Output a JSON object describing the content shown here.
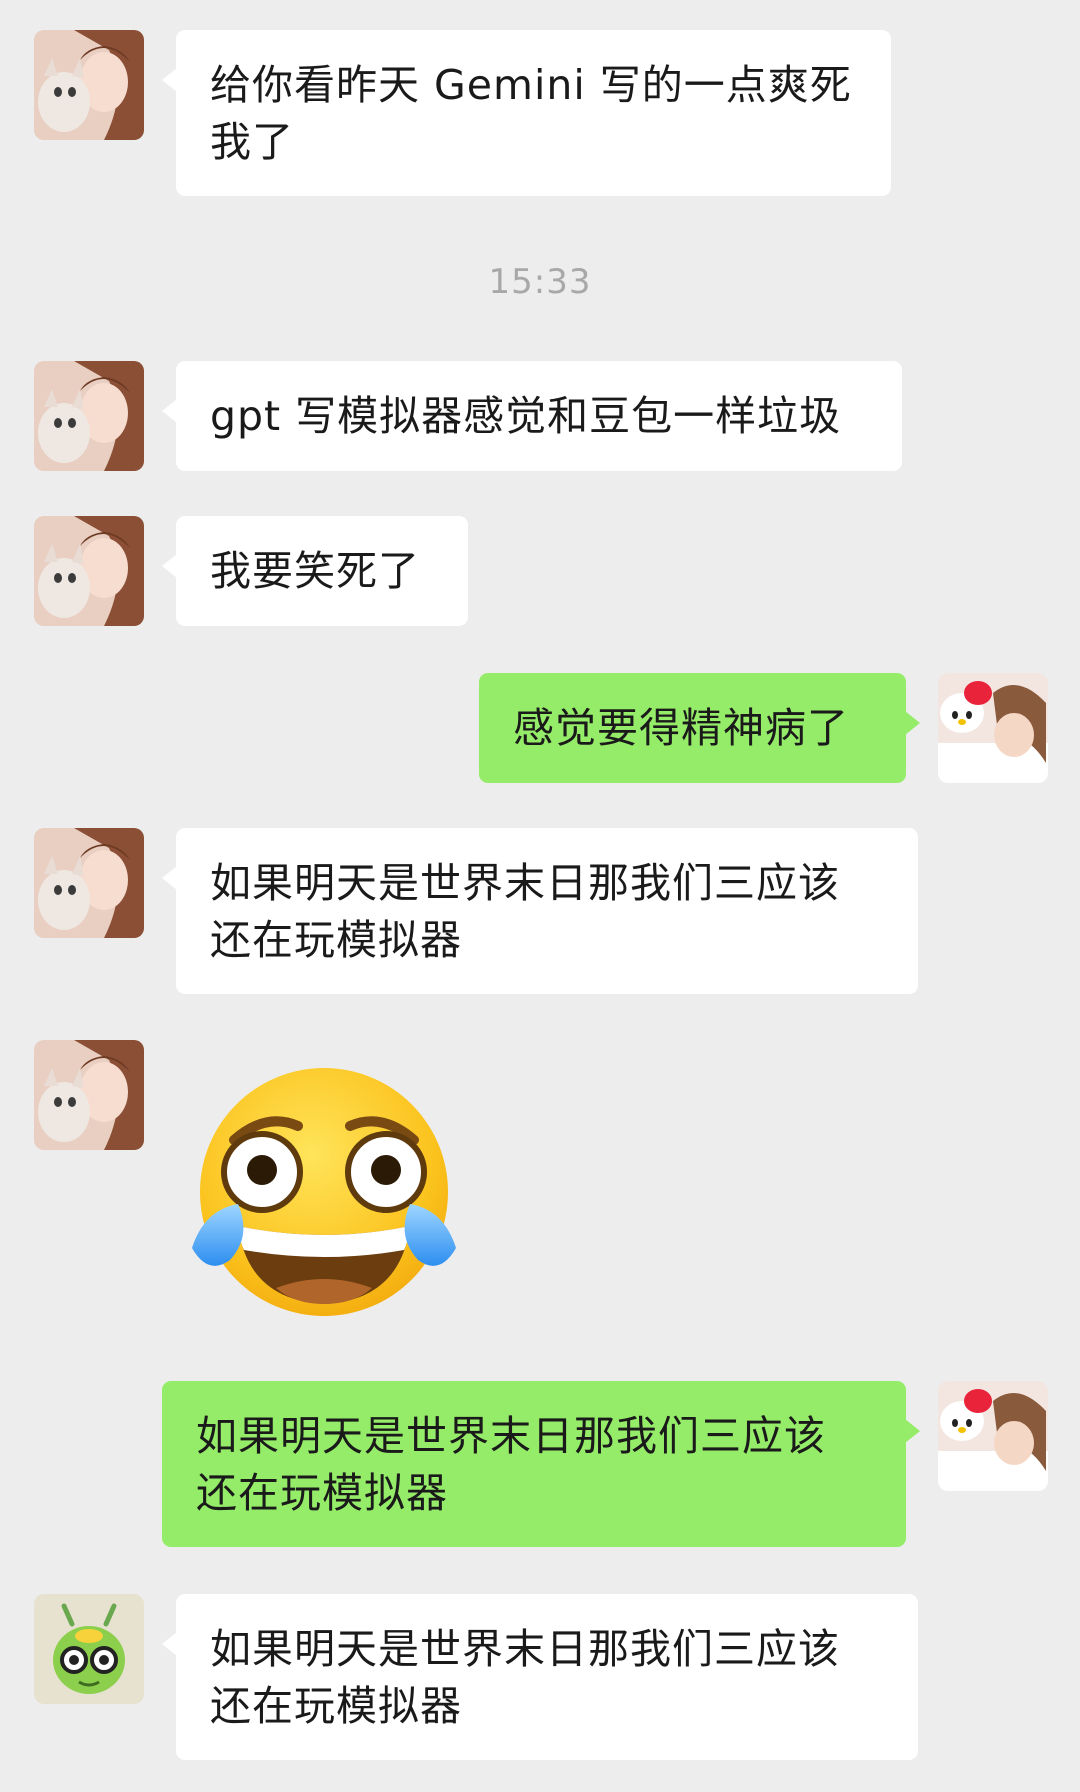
{
  "timestamp": "15:33",
  "messages": [
    {
      "side": "left",
      "sender": "friend",
      "lines": [
        "给你看昨天 Gemini 写的一点爽死",
        "我了"
      ]
    },
    {
      "side": "left",
      "sender": "friend",
      "lines": [
        "gpt 写模拟器感觉和豆包一样垃圾"
      ]
    },
    {
      "side": "left",
      "sender": "friend",
      "lines": [
        "我要笑死了"
      ]
    },
    {
      "side": "right",
      "sender": "self",
      "lines": [
        "感觉要得精神病了"
      ]
    },
    {
      "side": "left",
      "sender": "friend",
      "lines": [
        "如果明天是世界末日那我们三应该",
        "还在玩模拟器"
      ]
    },
    {
      "side": "left",
      "sender": "friend",
      "sticker": "tears-of-joy-emoji"
    },
    {
      "side": "right",
      "sender": "self",
      "lines": [
        "如果明天是世界末日那我们三应该",
        "还在玩模拟器"
      ]
    },
    {
      "side": "left",
      "sender": "friend2",
      "lines": [
        "如果明天是世界末日那我们三应该",
        "还在玩模拟器"
      ]
    }
  ],
  "colors": {
    "background": "#ededed",
    "incoming_bubble": "#ffffff",
    "outgoing_bubble": "#95ec69",
    "timestamp_text": "#a8a8a8"
  }
}
